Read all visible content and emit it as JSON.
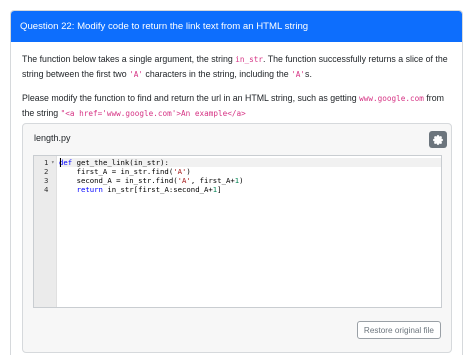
{
  "question": {
    "title": "Question 22: Modify code to return the link text from an HTML string",
    "para1_a": "The function below takes a single argument, the string ",
    "para1_code1": "in_str",
    "para1_b": ". The function successfully returns a slice of the string between the first two ",
    "para1_code2": "'A'",
    "para1_c": " characters in the string, including the ",
    "para1_code3": "'A'",
    "para1_d": "s.",
    "para2_a": "Please modify the function to find and return the url in an HTML string, such as getting ",
    "para2_code1": "www.google.com",
    "para2_b": " from the string ",
    "para2_code2": "\"<a href='www.google.com'>An example</a>",
    "para2_c": ""
  },
  "editor": {
    "file_name": "length.py",
    "settings_icon": "gear-icon",
    "line_numbers": [
      "1",
      "2",
      "3",
      "4"
    ],
    "code_lines": [
      "def get_the_link(in_str):",
      "    first_A = in_str.find('A')",
      "    second_A = in_str.find('A', first_A+1)",
      "    return in_str[first_A:second_A+1]"
    ],
    "restore_label": "Restore original file"
  },
  "colors": {
    "header_bg": "#0d6efd",
    "inline_code": "#d63384",
    "keyword": "#0000ff",
    "string": "#a31515",
    "number": "#098658"
  }
}
